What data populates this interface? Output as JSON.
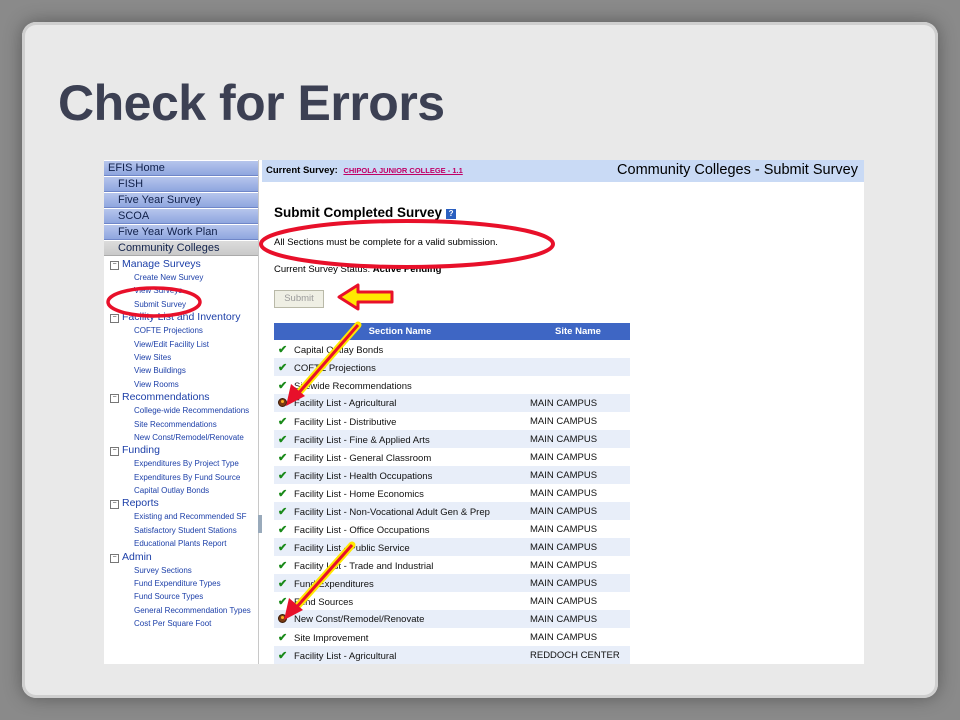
{
  "slide_title": "Check for Errors",
  "nav": {
    "buttons": [
      "EFIS Home",
      "FISH",
      "Five Year Survey",
      "SCOA",
      "Five Year Work Plan",
      "Community Colleges"
    ],
    "groups": [
      {
        "label": "Manage Surveys",
        "items": [
          "Create New Survey",
          "View Surveys",
          "Submit Survey"
        ]
      },
      {
        "label": "Facility List and Inventory",
        "items": [
          "COFTE Projections",
          "View/Edit Facility List",
          "View Sites",
          "View Buildings",
          "View Rooms"
        ]
      },
      {
        "label": "Recommendations",
        "items": [
          "College-wide Recommendations",
          "Site Recommendations",
          "New Const/Remodel/Renovate"
        ]
      },
      {
        "label": "Funding",
        "items": [
          "Expenditures By Project Type",
          "Expenditures By Fund Source",
          "Capital Outlay Bonds"
        ]
      },
      {
        "label": "Reports",
        "items": [
          "Existing and Recommended SF",
          "Satisfactory Student Stations",
          "Educational Plants Report"
        ]
      },
      {
        "label": "Admin",
        "items": [
          "Survey Sections",
          "Fund Expenditure Types",
          "Fund Source Types",
          "General Recommendation Types",
          "Cost Per Square Foot"
        ]
      }
    ]
  },
  "header": {
    "current_label": "Current Survey:",
    "current_value": "CHIPOLA JUNIOR COLLEGE - 1.1",
    "page_title": "Community Colleges - Submit Survey"
  },
  "content": {
    "heading": "Submit Completed Survey",
    "help": "?",
    "note": "All Sections must be complete for a valid submission.",
    "status_label": "Current Survey Status:",
    "status_value": "Active Pending",
    "submit_label": "Submit"
  },
  "table": {
    "headers": [
      "Section Name",
      "Site Name"
    ],
    "rows": [
      {
        "status": "ok",
        "section": "Capital Outlay Bonds",
        "site": ""
      },
      {
        "status": "ok",
        "section": "COFTE Projections",
        "site": ""
      },
      {
        "status": "ok",
        "section": "Sitewide Recommendations",
        "site": ""
      },
      {
        "status": "error",
        "section": "Facility List - Agricultural",
        "site": "MAIN CAMPUS"
      },
      {
        "status": "ok",
        "section": "Facility List - Distributive",
        "site": "MAIN CAMPUS"
      },
      {
        "status": "ok",
        "section": "Facility List - Fine & Applied Arts",
        "site": "MAIN CAMPUS"
      },
      {
        "status": "ok",
        "section": "Facility List - General Classroom",
        "site": "MAIN CAMPUS"
      },
      {
        "status": "ok",
        "section": "Facility List - Health Occupations",
        "site": "MAIN CAMPUS"
      },
      {
        "status": "ok",
        "section": "Facility List - Home Economics",
        "site": "MAIN CAMPUS"
      },
      {
        "status": "ok",
        "section": "Facility List - Non-Vocational Adult Gen & Prep",
        "site": "MAIN CAMPUS"
      },
      {
        "status": "ok",
        "section": "Facility List - Office Occupations",
        "site": "MAIN CAMPUS"
      },
      {
        "status": "ok",
        "section": "Facility List - Public Service",
        "site": "MAIN CAMPUS"
      },
      {
        "status": "ok",
        "section": "Facility List - Trade and Industrial",
        "site": "MAIN CAMPUS"
      },
      {
        "status": "ok",
        "section": "Fund Expenditures",
        "site": "MAIN CAMPUS"
      },
      {
        "status": "ok",
        "section": "Fund Sources",
        "site": "MAIN CAMPUS"
      },
      {
        "status": "error",
        "section": "New Const/Remodel/Renovate",
        "site": "MAIN CAMPUS"
      },
      {
        "status": "ok",
        "section": "Site Improvement",
        "site": "MAIN CAMPUS"
      },
      {
        "status": "ok",
        "section": "Facility List - Agricultural",
        "site": "REDDOCH CENTER"
      }
    ]
  },
  "colors": {
    "annotation_red": "#e8102a",
    "arrow_yellow": "#ffe800",
    "nav_blue": "#8fa6df",
    "table_header": "#3e66c4"
  }
}
